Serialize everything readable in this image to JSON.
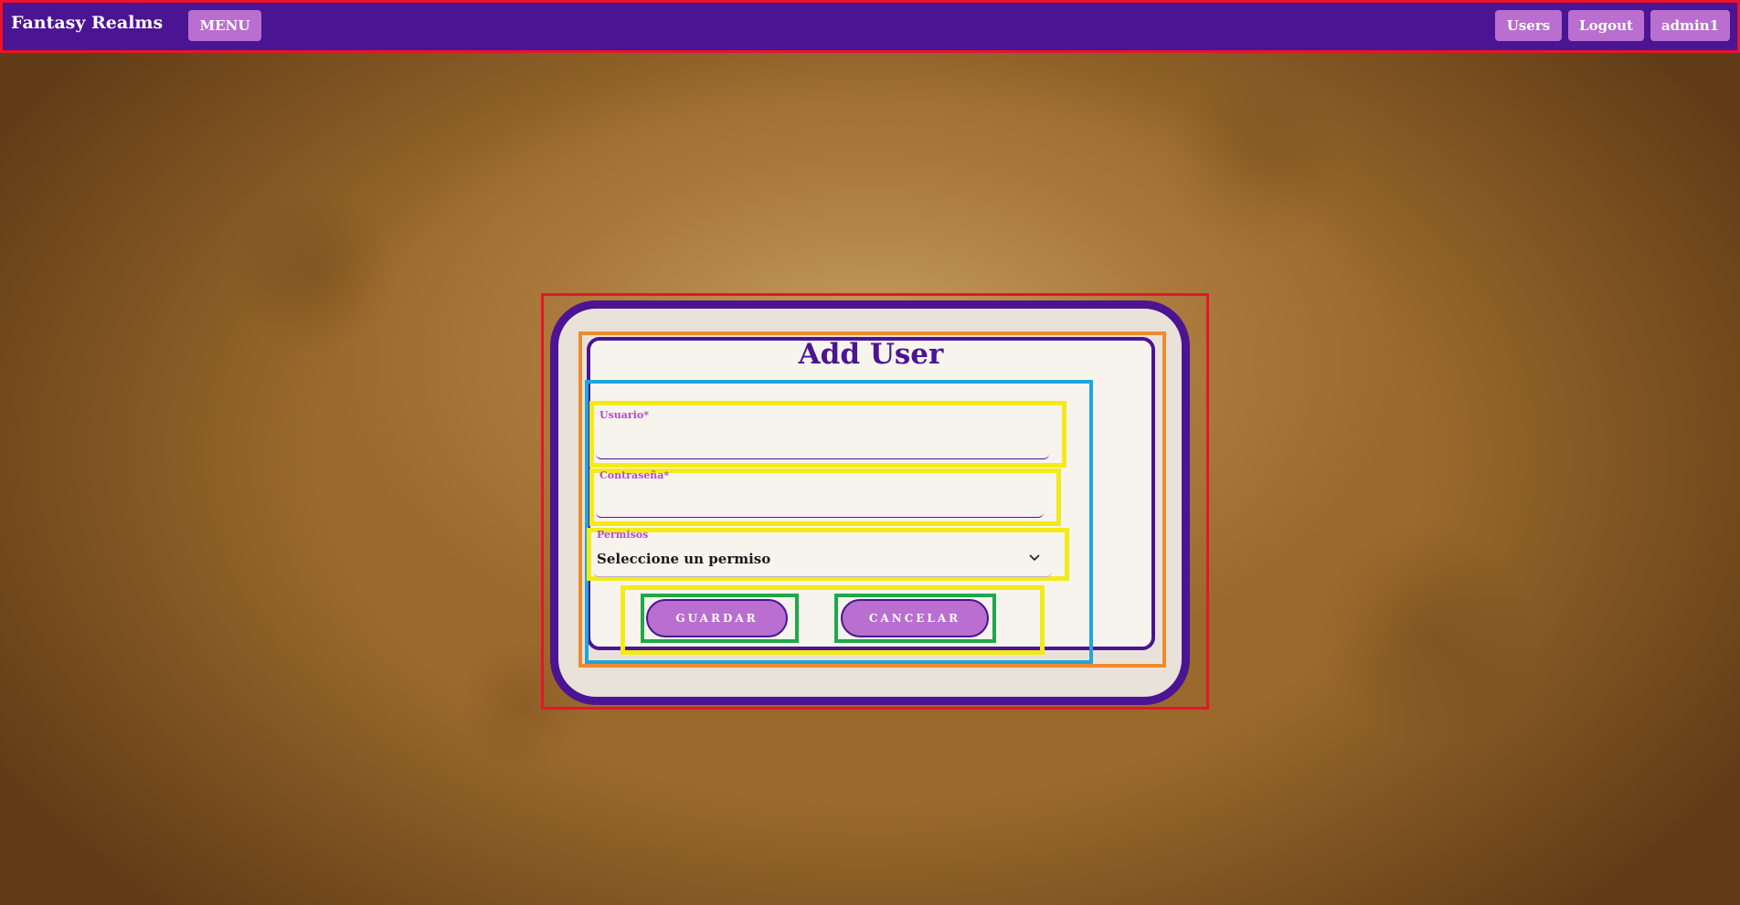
{
  "navbar": {
    "brand": "Fantasy Realms",
    "menu_label": "MENU",
    "links": [
      {
        "label": "Users"
      },
      {
        "label": "Logout"
      },
      {
        "label": "admin1"
      }
    ]
  },
  "form": {
    "title": "Add User",
    "fields": {
      "usuario": {
        "label": "Usuario",
        "required_mark": "*",
        "value": ""
      },
      "password": {
        "label": "Contraseña",
        "required_mark": "*",
        "value": ""
      },
      "permiso": {
        "label": "Permisos",
        "selected": "Seleccione un permiso"
      }
    },
    "buttons": {
      "save": "GUARDAR",
      "cancel": "CANCELAR"
    }
  },
  "colors": {
    "primary_purple": "#4b1493",
    "accent_lilac": "#b96ed0",
    "label_magenta": "#b24cc6",
    "panel_bg": "#f7f4ee"
  },
  "icons": {
    "select_arrow": "chevron-down-icon"
  }
}
